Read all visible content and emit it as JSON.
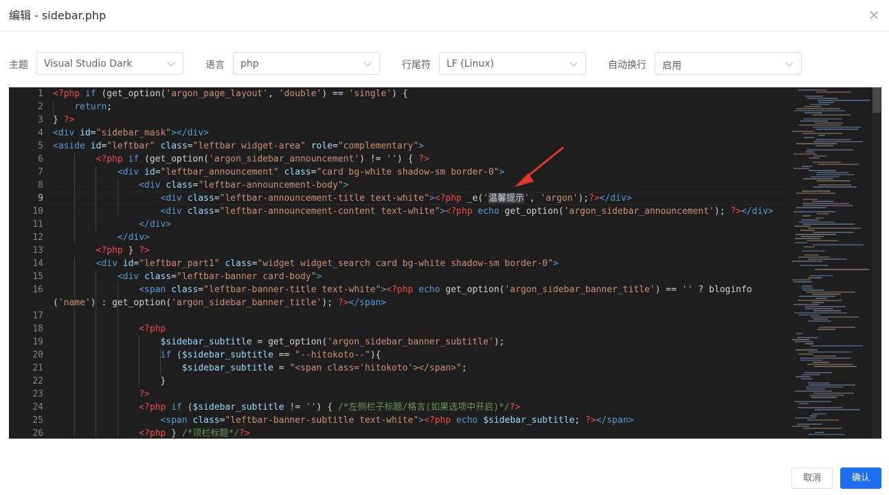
{
  "dialog": {
    "title": "编辑 - sidebar.php"
  },
  "toolbar": {
    "theme_label": "主题",
    "theme_value": "Visual Studio Dark",
    "language_label": "语言",
    "language_value": "php",
    "eol_label": "行尾符",
    "eol_value": "LF (Linux)",
    "wrap_label": "自动换行",
    "wrap_value": "启用"
  },
  "editor": {
    "line_numbers": [
      "1",
      "2",
      "3",
      "4",
      "5",
      "6",
      "7",
      "8",
      "9",
      "10",
      "11",
      "12",
      "13",
      "14",
      "15",
      "16",
      "",
      "17",
      "18",
      "19",
      "20",
      "21",
      "22",
      "23",
      "24",
      "25",
      "26"
    ],
    "active_line": "9",
    "lines": [
      [
        [
          "ph",
          "<?php "
        ],
        [
          "kw",
          "if "
        ],
        [
          "pl",
          "(get_option("
        ],
        [
          "st",
          "'argon_page_layout'"
        ],
        [
          "pl",
          ", "
        ],
        [
          "st",
          "'double'"
        ],
        [
          "pl",
          ") == "
        ],
        [
          "st",
          "'single'"
        ],
        [
          "pl",
          ") {"
        ]
      ],
      [
        [
          "pl",
          "    "
        ],
        [
          "kw",
          "return"
        ],
        [
          "pl",
          ";"
        ]
      ],
      [
        [
          "pl",
          "} "
        ],
        [
          "ph",
          "?>"
        ]
      ],
      [
        [
          "tg",
          "<div "
        ],
        [
          "at",
          "id"
        ],
        [
          "pl",
          "="
        ],
        [
          "st",
          "\"sidebar_mask\""
        ],
        [
          "tg",
          "></div>"
        ]
      ],
      [
        [
          "tg",
          "<aside "
        ],
        [
          "at",
          "id"
        ],
        [
          "pl",
          "="
        ],
        [
          "st",
          "\"leftbar\" "
        ],
        [
          "at",
          "class"
        ],
        [
          "pl",
          "="
        ],
        [
          "st",
          "\"leftbar widget-area\" "
        ],
        [
          "at",
          "role"
        ],
        [
          "pl",
          "="
        ],
        [
          "st",
          "\"complementary\""
        ],
        [
          "tg",
          ">"
        ]
      ],
      [
        [
          "pl",
          "        "
        ],
        [
          "ph",
          "<?php "
        ],
        [
          "kw",
          "if "
        ],
        [
          "pl",
          "(get_option("
        ],
        [
          "st",
          "'argon_sidebar_announcement'"
        ],
        [
          "pl",
          ") != "
        ],
        [
          "st",
          "''"
        ],
        [
          "pl",
          ") { "
        ],
        [
          "ph",
          "?>"
        ]
      ],
      [
        [
          "pl",
          "            "
        ],
        [
          "tg",
          "<div "
        ],
        [
          "at",
          "id"
        ],
        [
          "pl",
          "="
        ],
        [
          "st",
          "\"leftbar_announcement\" "
        ],
        [
          "at",
          "class"
        ],
        [
          "pl",
          "="
        ],
        [
          "st",
          "\"card bg-white shadow-sm border-0\""
        ],
        [
          "tg",
          ">"
        ]
      ],
      [
        [
          "pl",
          "                "
        ],
        [
          "tg",
          "<div "
        ],
        [
          "at",
          "class"
        ],
        [
          "pl",
          "="
        ],
        [
          "st",
          "\"leftbar-announcement-body\""
        ],
        [
          "tg",
          ">"
        ]
      ],
      [
        [
          "pl",
          "                    "
        ],
        [
          "tg",
          "<div "
        ],
        [
          "at",
          "class"
        ],
        [
          "pl",
          "="
        ],
        [
          "st",
          "\"leftbar-announcement-title text-white\""
        ],
        [
          "tg",
          ">"
        ],
        [
          "ph",
          "<?php "
        ],
        [
          "pl",
          "_e("
        ],
        [
          "st",
          "'"
        ],
        [
          "sel",
          "温馨提示"
        ],
        [
          "st",
          "'"
        ],
        [
          "pl",
          ", "
        ],
        [
          "st",
          "'argon'"
        ],
        [
          "pl",
          ");"
        ],
        [
          "ph",
          "?>"
        ],
        [
          "tg",
          "</div>"
        ]
      ],
      [
        [
          "pl",
          "                    "
        ],
        [
          "tg",
          "<div "
        ],
        [
          "at",
          "class"
        ],
        [
          "pl",
          "="
        ],
        [
          "st",
          "\"leftbar-announcement-content text-white\""
        ],
        [
          "tg",
          ">"
        ],
        [
          "ph",
          "<?php "
        ],
        [
          "kw",
          "echo "
        ],
        [
          "pl",
          "get_option("
        ],
        [
          "st",
          "'argon_sidebar_announcement'"
        ],
        [
          "pl",
          "); "
        ],
        [
          "ph",
          "?>"
        ],
        [
          "tg",
          "</div>"
        ]
      ],
      [
        [
          "pl",
          "                "
        ],
        [
          "tg",
          "</div>"
        ]
      ],
      [
        [
          "pl",
          "            "
        ],
        [
          "tg",
          "</div>"
        ]
      ],
      [
        [
          "pl",
          "        "
        ],
        [
          "ph",
          "<?php "
        ],
        [
          "pl",
          "} "
        ],
        [
          "ph",
          "?>"
        ]
      ],
      [
        [
          "pl",
          "        "
        ],
        [
          "tg",
          "<div "
        ],
        [
          "at",
          "id"
        ],
        [
          "pl",
          "="
        ],
        [
          "st",
          "\"leftbar_part1\" "
        ],
        [
          "at",
          "class"
        ],
        [
          "pl",
          "="
        ],
        [
          "st",
          "\"widget widget_search card bg-white shadow-sm border-0\""
        ],
        [
          "tg",
          ">"
        ]
      ],
      [
        [
          "pl",
          "            "
        ],
        [
          "tg",
          "<div "
        ],
        [
          "at",
          "class"
        ],
        [
          "pl",
          "="
        ],
        [
          "st",
          "\"leftbar-banner card-body\""
        ],
        [
          "tg",
          ">"
        ]
      ],
      [
        [
          "pl",
          "                "
        ],
        [
          "tg",
          "<span "
        ],
        [
          "at",
          "class"
        ],
        [
          "pl",
          "="
        ],
        [
          "st",
          "\"leftbar-banner-title text-white\""
        ],
        [
          "tg",
          ">"
        ],
        [
          "ph",
          "<?php "
        ],
        [
          "kw",
          "echo "
        ],
        [
          "pl",
          "get_option("
        ],
        [
          "st",
          "'argon_sidebar_banner_title'"
        ],
        [
          "pl",
          ") == "
        ],
        [
          "st",
          "'' "
        ],
        [
          "pl",
          "? bloginfo"
        ]
      ],
      [
        [
          "pl",
          "("
        ],
        [
          "st",
          "'name'"
        ],
        [
          "pl",
          ") : get_option("
        ],
        [
          "st",
          "'argon_sidebar_banner_title'"
        ],
        [
          "pl",
          "); "
        ],
        [
          "ph",
          "?>"
        ],
        [
          "tg",
          "</span>"
        ]
      ],
      [
        [
          "pl",
          ""
        ]
      ],
      [
        [
          "pl",
          "                "
        ],
        [
          "ph",
          "<?php"
        ]
      ],
      [
        [
          "pl",
          "                    "
        ],
        [
          "vr",
          "$sidebar_subtitle"
        ],
        [
          "pl",
          " = get_option("
        ],
        [
          "st",
          "'argon_sidebar_banner_subtitle'"
        ],
        [
          "pl",
          ");"
        ]
      ],
      [
        [
          "pl",
          "                    "
        ],
        [
          "kw",
          "if "
        ],
        [
          "pl",
          "("
        ],
        [
          "vr",
          "$sidebar_subtitle"
        ],
        [
          "pl",
          " == "
        ],
        [
          "st",
          "\"--hitokoto--\""
        ],
        [
          "pl",
          "){"
        ]
      ],
      [
        [
          "pl",
          "                        "
        ],
        [
          "vr",
          "$sidebar_subtitle"
        ],
        [
          "pl",
          " = "
        ],
        [
          "st",
          "\"<span class='hitokoto'></span>\""
        ],
        [
          "pl",
          ";"
        ]
      ],
      [
        [
          "pl",
          "                    }"
        ]
      ],
      [
        [
          "pl",
          "                "
        ],
        [
          "ph",
          "?>"
        ]
      ],
      [
        [
          "pl",
          "                "
        ],
        [
          "ph",
          "<?php "
        ],
        [
          "kw",
          "if "
        ],
        [
          "pl",
          "("
        ],
        [
          "vr",
          "$sidebar_subtitle"
        ],
        [
          "pl",
          " != "
        ],
        [
          "st",
          "''"
        ],
        [
          "pl",
          ") { "
        ],
        [
          "cm",
          "/*左侧栏子标题/格言(如果选项中开启)*/"
        ],
        [
          "ph",
          "?>"
        ]
      ],
      [
        [
          "pl",
          "                    "
        ],
        [
          "tg",
          "<span "
        ],
        [
          "at",
          "class"
        ],
        [
          "pl",
          "="
        ],
        [
          "st",
          "\"leftbar-banner-subtitle text-white\""
        ],
        [
          "tg",
          ">"
        ],
        [
          "ph",
          "<?php "
        ],
        [
          "kw",
          "echo "
        ],
        [
          "vr",
          "$sidebar_subtitle"
        ],
        [
          "pl",
          "; "
        ],
        [
          "ph",
          "?>"
        ],
        [
          "tg",
          "</span>"
        ]
      ],
      [
        [
          "pl",
          "                "
        ],
        [
          "ph",
          "<?php "
        ],
        [
          "pl",
          "} "
        ],
        [
          "cm",
          "/*顶栏标题*/"
        ],
        [
          "ph",
          "?>"
        ]
      ]
    ]
  },
  "colors": {
    "editor_bg": "#1e1e1e",
    "primary": "#1e6ff0",
    "arrow": "#e8342a"
  },
  "icons": {
    "close": "close-icon",
    "chevron": "chevron-down-icon",
    "arrow": "annotation-arrow-icon"
  },
  "footer": {
    "cancel_label": "取消",
    "confirm_label": "确认"
  }
}
